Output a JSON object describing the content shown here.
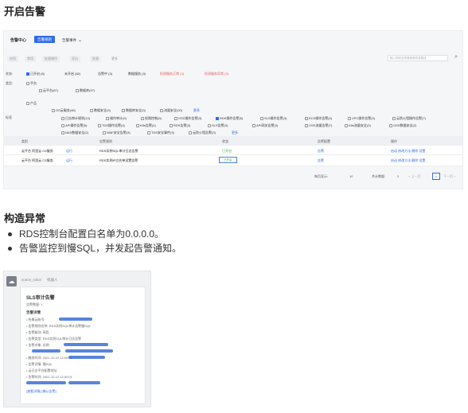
{
  "headings": {
    "enable_alerts": "开启告警",
    "construct_anomaly": "构造异常"
  },
  "shot1": {
    "title": "告警中心",
    "primary_btn": "告警规则",
    "dropdown": "告警事件",
    "filter_buttons": [
      "启用",
      "禁用",
      "批量操作",
      "导出",
      "批量",
      "更多"
    ],
    "search_placeholder": "输入规则名称搜索规则或描述",
    "status_label": "状态:",
    "status_options": [
      "已开启 (6)",
      "未开启 (82)",
      "告警中 (3)",
      "数据服务 (3)",
      "检测服务正常 (3)",
      "检测服务异常 (3)"
    ],
    "type_label": "类型:",
    "type_platform": "平台",
    "type_platform_items": [
      "云平台(67)",
      "数据库(97)"
    ],
    "type_product": "产品",
    "type_product_items": [
      "OS云服务(46)",
      "数据安全(3)",
      "数据库安全(3)",
      "流量安全(20)"
    ],
    "type_extra": "更多",
    "tag_label": "标签",
    "tag_items_row1": [
      "日志审计规则(13)",
      "操作审计(9)",
      "权限控制(5)",
      "OSS操作告警(3)",
      "RDS操作告警(5)",
      "SLS操作告警(3)",
      "ECS操作告警(4)",
      "VPC操作告警(3)",
      "云防火墙操作告警(7)"
    ],
    "tag_items_row2": [
      "API操作告警(5)",
      "TDS操作告警(4)",
      "K8s告警(4)",
      "RDS告警(3)",
      "SLS告警(3)",
      "API网关告警(3)",
      "OSS流量告警(7)",
      "K8s流量安全(3)",
      "OSS数据安全(2)"
    ],
    "tag_items_row3": [
      "NAS数据安全(2)",
      "WAF安全告警(3)",
      "TDS安全事件(3)",
      "云防火墙告警(3)",
      "更多"
    ],
    "table_headers": [
      "类别",
      "告警规则",
      "状态",
      "告警配置",
      "操作"
    ],
    "rows": [
      {
        "category": "云平台 阿里云 CS服务",
        "cat_tag": "运行",
        "rule": "RDS实例SQL审计日志告警",
        "status": "已开启",
        "config": "告警",
        "actions": "启动 修改方法 删除 设置"
      },
      {
        "category": "云平台 阿里云 CS服务",
        "cat_tag": "运行",
        "rule": "RDS实例IP白名单设置告警",
        "status": "已开启",
        "config": "告警",
        "actions": "启动 修改方法 删除 设置"
      }
    ],
    "pager": {
      "per_page_label": "每页显示:",
      "per_page": "10",
      "total": "共计数据:",
      "total_num": "2",
      "prev": "< 上一页",
      "current": "1",
      "next": "下一页 >"
    }
  },
  "bullets": [
    "RDS控制台配置白名单为0.0.0.0。",
    "告警监控到慢SQL，并发起告警通知。"
  ],
  "shot2": {
    "sender": "yunce_robot",
    "sender_tag": "机器人",
    "card_title": "SLS审计告警",
    "card_line1": "告警数量: 1",
    "card_sub": "告警详情",
    "card_lines": [
      "• 所属云账号:",
      "• 告警规则名称: RDS实例SQL审计告警慢SQL",
      "• 告警级别: 高危",
      "• 告警类型: RDS实例SQL审计日志告警",
      "• 告警对象: 实例",
      "• 触发时间: 2021-12-12 12:00:00",
      "• 告警详情: 慢SQL",
      "• 云日志平台配置地址",
      "• 告警时间: 2021-12-12 12:00:01"
    ],
    "card_link": "[查看详情] [确认告警]"
  }
}
